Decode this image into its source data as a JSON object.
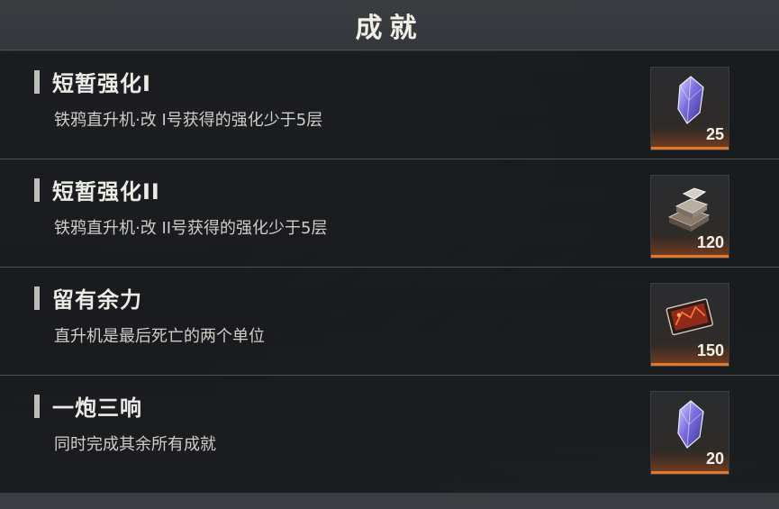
{
  "header": {
    "title": "成就"
  },
  "achievements": [
    {
      "title": "短暂强化I",
      "description": "铁鸦直升机·改 I号获得的强化少于5层",
      "reward": {
        "icon": "crystal-icon",
        "count": "25"
      }
    },
    {
      "title": "短暂强化II",
      "description": "铁鸦直升机·改 II号获得的强化少于5层",
      "reward": {
        "icon": "metal-ingot-icon",
        "count": "120"
      }
    },
    {
      "title": "留有余力",
      "description": "直升机是最后死亡的两个单位",
      "reward": {
        "icon": "red-card-icon",
        "count": "150"
      }
    },
    {
      "title": "一炮三响",
      "description": "同时完成其余所有成就",
      "reward": {
        "icon": "crystal-icon",
        "count": "20"
      }
    }
  ],
  "colors": {
    "accent": "#e07a2a",
    "crystal": "#7a6fd6",
    "card": "#b8351f"
  }
}
